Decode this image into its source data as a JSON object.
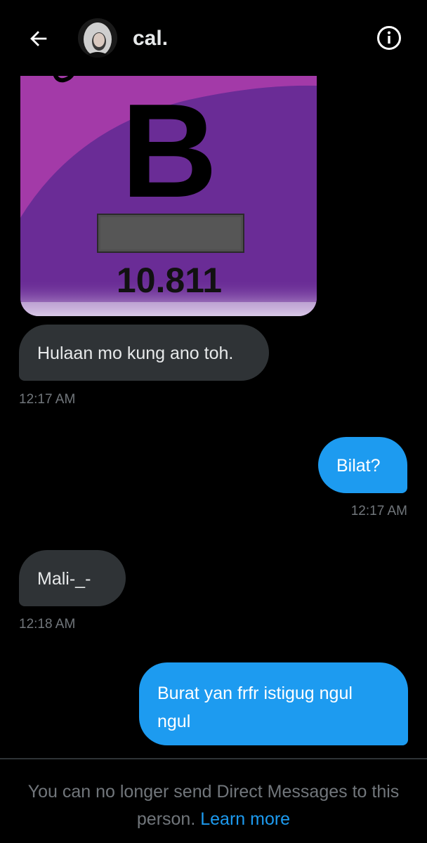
{
  "header": {
    "contact_name": "cal.",
    "back_icon": "arrow-left-icon",
    "info_icon": "info-circle-icon"
  },
  "shared_image": {
    "element_symbol": "B",
    "atomic_mass": "10.811",
    "colors": {
      "primary": "#6a2c96",
      "accent": "#a33aa8"
    }
  },
  "messages": [
    {
      "direction": "incoming",
      "text": "Hulaan mo kung ano toh.",
      "time": "12:17 AM"
    },
    {
      "direction": "outgoing",
      "text": "Bilat?",
      "time": "12:17 AM"
    },
    {
      "direction": "incoming",
      "text": "Mali-_-",
      "time": "12:18 AM"
    },
    {
      "direction": "outgoing",
      "text": "Burat yan frfr istigug ngul ngul",
      "time": ""
    }
  ],
  "footer": {
    "notice_text": "You can no longer send Direct Messages to this person.",
    "learn_more_label": "Learn more"
  },
  "colors": {
    "background": "#000000",
    "incoming_bubble": "#2f3336",
    "outgoing_bubble": "#1d9bf0",
    "link": "#1d9bf0",
    "muted_text": "#71767b"
  }
}
